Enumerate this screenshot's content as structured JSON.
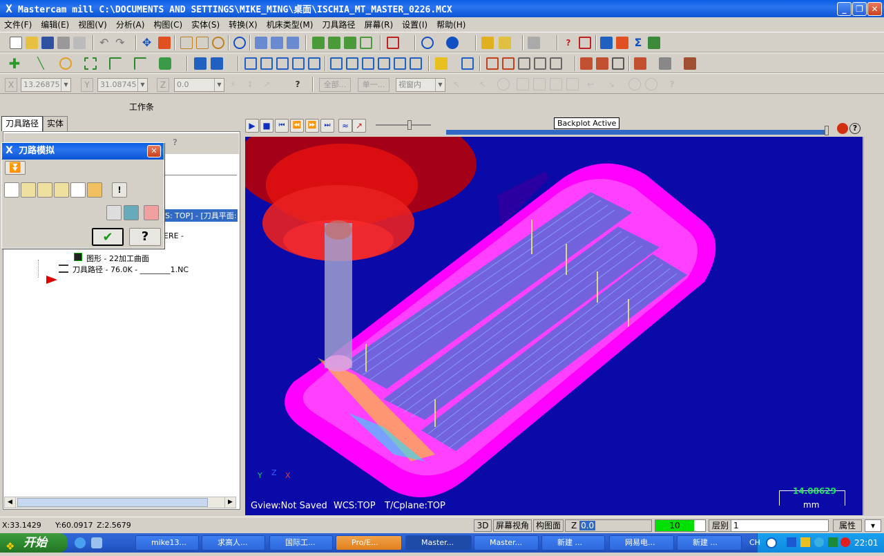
{
  "window": {
    "title": "Mastercam mill  C:\\DOCUMENTS AND SETTINGS\\MIKE_MING\\桌面\\ISCHIA_MT_MASTER_0226.MCX",
    "logo": "X",
    "min_label": "_",
    "max_label": "❐",
    "close_label": "✕"
  },
  "menu": {
    "items": [
      "文件(F)",
      "编辑(E)",
      "视图(V)",
      "分析(A)",
      "构图(C)",
      "实体(S)",
      "转换(X)",
      "机床类型(M)",
      "刀具路径",
      "屏幕(R)",
      "设置(I)",
      "帮助(H)"
    ]
  },
  "coordbar": {
    "x_label": "X",
    "x_value": "13.26875",
    "y_label": "Y",
    "y_value": "31.08745",
    "z_label": "Z",
    "z_value": "0.0",
    "all_label": "全部...",
    "single_label": "单一...",
    "window_select": "视窗内"
  },
  "workbar": {
    "label": "工作条"
  },
  "leftpanel": {
    "tabs": [
      "刀具路径",
      "实体"
    ],
    "tree": {
      "selected_row": "S: TOP] - [刀具平面:",
      "row2": "ERE -",
      "row3": "图形 - 22加工曲面",
      "row4": "刀具路径 - 76.0K - ________1.NC"
    }
  },
  "dialog": {
    "title": "刀路模拟",
    "close_label": "✕",
    "ok_label": "✔",
    "help_label": "?"
  },
  "viewport": {
    "backplot_tooltip": "Backplot Active",
    "gview": "Gview:Not Saved",
    "wcs": "WCS:TOP",
    "tplane": "T/Cplane:TOP",
    "scale_value": "14.08629",
    "scale_unit": "mm",
    "axis_y": "Y",
    "axis_z": "Z",
    "axis_x": "X",
    "bg_color": "#0a0aa8",
    "part_color": "#ff00ff"
  },
  "status": {
    "x": "X:33.1429",
    "y": "Y:60.0917",
    "z": "Z:2.5679",
    "mode_3d": "3D",
    "screen_view": "屏幕视角",
    "cplane": "构图面",
    "z_label": "Z",
    "z_value": "0.0",
    "color_value": "10",
    "level_label": "层别",
    "level_value": "1",
    "attr_label": "属性"
  },
  "taskbar": {
    "start_label": "开始",
    "tasks": [
      "mike13...",
      "求高人...",
      "国际工...",
      "Pro/E...",
      "Master...",
      "Master...",
      "新建 ...",
      "网易电...",
      "新建 ..."
    ],
    "lang": "CH",
    "clock": "22:01"
  }
}
